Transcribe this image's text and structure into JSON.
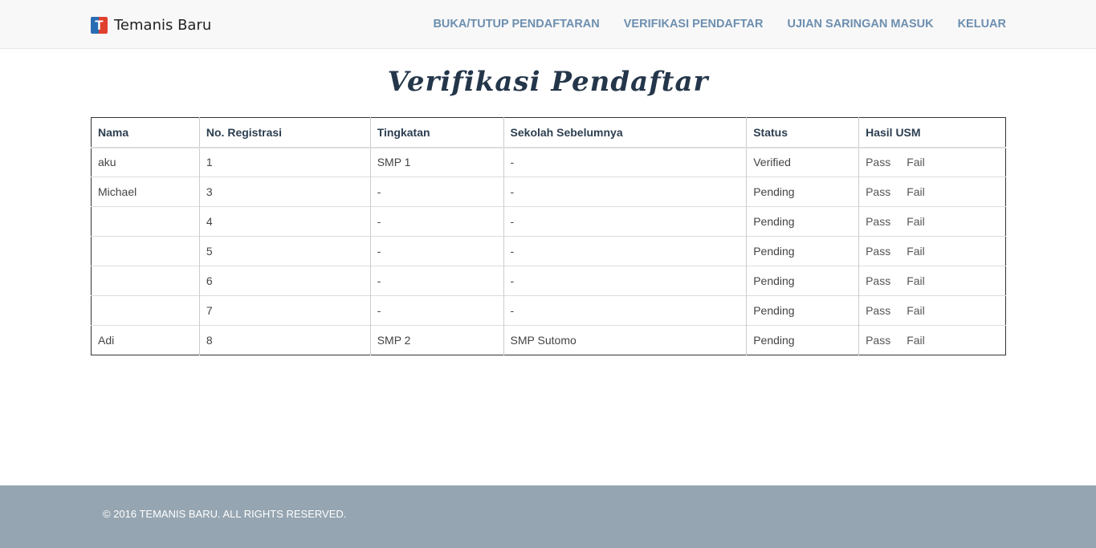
{
  "brand": {
    "name": "Temanis Baru",
    "logo_letter": "T"
  },
  "nav": {
    "items": [
      {
        "label": "BUKA/TUTUP PENDAFTARAN"
      },
      {
        "label": "VERIFIKASI PENDAFTAR"
      },
      {
        "label": "UJIAN SARINGAN MASUK"
      },
      {
        "label": "KELUAR"
      }
    ]
  },
  "page": {
    "title": "Verifikasi Pendaftar"
  },
  "table": {
    "headers": [
      "Nama",
      "No. Registrasi",
      "Tingkatan",
      "Sekolah Sebelumnya",
      "Status",
      "Hasil USM"
    ],
    "pass_label": "Pass",
    "fail_label": "Fail",
    "rows": [
      {
        "nama": "aku",
        "no": "1",
        "tingkatan": "SMP 1",
        "sekolah": "-",
        "status": "Verified"
      },
      {
        "nama": "Michael",
        "no": "3",
        "tingkatan": "-",
        "sekolah": "-",
        "status": "Pending"
      },
      {
        "nama": "",
        "no": "4",
        "tingkatan": "-",
        "sekolah": "-",
        "status": "Pending"
      },
      {
        "nama": "",
        "no": "5",
        "tingkatan": "-",
        "sekolah": "-",
        "status": "Pending"
      },
      {
        "nama": "",
        "no": "6",
        "tingkatan": "-",
        "sekolah": "-",
        "status": "Pending"
      },
      {
        "nama": "",
        "no": "7",
        "tingkatan": "-",
        "sekolah": "-",
        "status": "Pending"
      },
      {
        "nama": "Adi",
        "no": "8",
        "tingkatan": "SMP 2",
        "sekolah": "SMP Sutomo",
        "status": "Pending"
      }
    ]
  },
  "footer": {
    "text": "© 2016 TEMANIS BARU. ALL RIGHTS RESERVED."
  },
  "colors": {
    "nav_link": "#6d8fb0",
    "title": "#24364a",
    "footer_bg": "#95a5b1",
    "logo_blue": "#2a6cb3",
    "logo_red": "#e0402e"
  }
}
